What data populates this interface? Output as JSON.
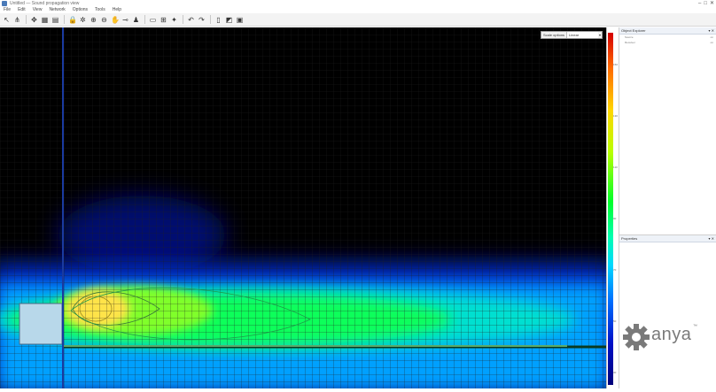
{
  "window": {
    "title": "Untitled — Sound propagation view",
    "controls": [
      "–",
      "□",
      "✕"
    ]
  },
  "menu": [
    "File",
    "Edit",
    "View",
    "Network",
    "Options",
    "Tools",
    "Help"
  ],
  "toolbar": [
    {
      "icon": "select-arrow-icon",
      "glyph": "↖"
    },
    {
      "icon": "network-icon",
      "glyph": "⋔"
    },
    {
      "sep": true
    },
    {
      "icon": "add-node-icon",
      "glyph": "✥"
    },
    {
      "icon": "grid-icon",
      "glyph": "▦"
    },
    {
      "icon": "table-icon",
      "glyph": "▤"
    },
    {
      "sep": true
    },
    {
      "icon": "lock-icon",
      "glyph": "🔒"
    },
    {
      "icon": "settings-icon",
      "glyph": "✲"
    },
    {
      "icon": "zoom-in-icon",
      "glyph": "⊕"
    },
    {
      "icon": "zoom-out-icon",
      "glyph": "⊖"
    },
    {
      "icon": "pan-icon",
      "glyph": "✋"
    },
    {
      "icon": "measure-icon",
      "glyph": "⊸"
    },
    {
      "icon": "person-icon",
      "glyph": "♟"
    },
    {
      "sep": true
    },
    {
      "icon": "chart-icon",
      "glyph": "▭"
    },
    {
      "icon": "ruler-icon",
      "glyph": "⊞"
    },
    {
      "icon": "star-icon",
      "glyph": "✦"
    },
    {
      "sep": true
    },
    {
      "icon": "undo-icon",
      "glyph": "↶"
    },
    {
      "icon": "redo-icon",
      "glyph": "↷"
    },
    {
      "sep": true
    },
    {
      "icon": "page-icon",
      "glyph": "▯"
    },
    {
      "icon": "export-icon",
      "glyph": "◩"
    },
    {
      "icon": "image-icon",
      "glyph": "▣"
    }
  ],
  "scale_control": {
    "label": "Scale options",
    "value": "Linear"
  },
  "legend_ticks": [
    "150",
    "130",
    "110",
    "90",
    "70",
    "50",
    "30"
  ],
  "explorer": {
    "title": "Object Explorer",
    "pin": "▾ ✕",
    "rows": [
      {
        "name": "Source",
        "value": "on"
      },
      {
        "name": "Receiver",
        "value": "on"
      }
    ]
  },
  "properties": {
    "title": "Properties",
    "pin": "▾ ✕"
  },
  "logo": {
    "text": "anya",
    "tm": "™"
  },
  "colors": {
    "background": "#000000",
    "grid": "#1d1d1d",
    "hot": "#ffe34a",
    "warm": "#7aff2e",
    "mid": "#18ff4a",
    "cool": "#00c8ff",
    "cold": "#0044d8",
    "low": "#000a70"
  }
}
